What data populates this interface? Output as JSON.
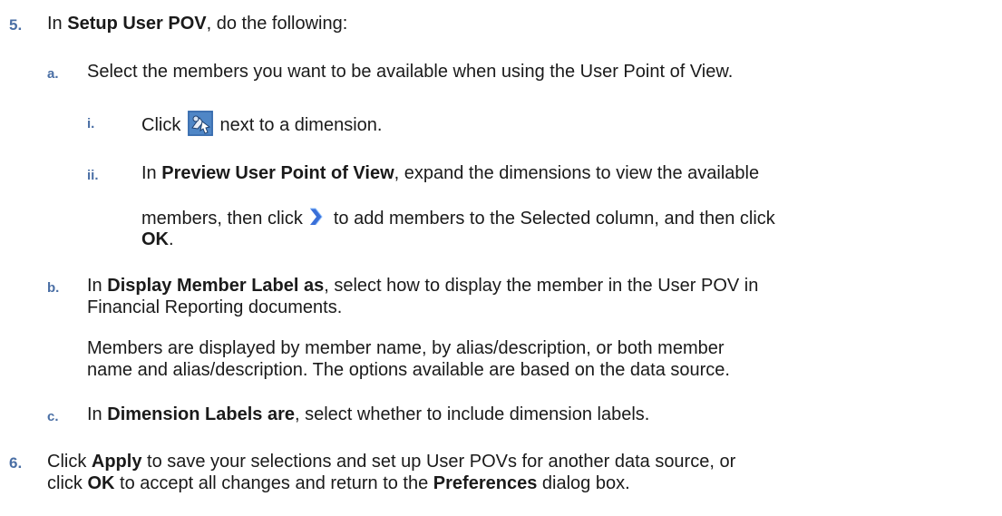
{
  "step5": {
    "number": "5.",
    "pre": "In ",
    "bold": "Setup User POV",
    "post": ", do the following:"
  },
  "step5a": {
    "number": "a.",
    "text": "Select the members you want to be available when using the User Point of View."
  },
  "step5ai": {
    "number": "i.",
    "pre": "Click",
    "post": "next to a dimension.",
    "icon": "member-selection-icon"
  },
  "step5aii": {
    "number": "ii.",
    "line1_pre": "In ",
    "line1_bold": "Preview User Point of View",
    "line1_post": ", expand the dimensions to view the available",
    "line2_pre": "members, then click",
    "line2_post": "to add members to the Selected column, and then click",
    "line3_bold": "OK",
    "line3_post": ".",
    "icon": "chevron-right-icon"
  },
  "step5b": {
    "number": "b.",
    "line1_pre": "In ",
    "line1_bold": "Display Member Label as",
    "line1_post": ", select how to display the member in the User POV in",
    "line2": "Financial Reporting documents.",
    "para1": "Members are displayed by member name, by alias/description, or both member",
    "para2": "name and alias/description. The options available are based on the data source."
  },
  "step5c": {
    "number": "c.",
    "pre": "In ",
    "bold": "Dimension Labels are",
    "post": ", select whether to include dimension labels."
  },
  "step6": {
    "number": "6.",
    "line1_pre": "Click ",
    "line1_bold": "Apply",
    "line1_post": " to save your selections and set up User POVs for another data source, or",
    "line2_pre": "click ",
    "line2_bold": "OK",
    "line2_mid": " to accept all changes and return to the ",
    "line2_bold2": "Preferences",
    "line2_post": " dialog box."
  },
  "colors": {
    "number": "#4a6fa5",
    "text": "#1a1a1a",
    "icon_bg": "#4f86c6",
    "chevron": "#3a6fd8"
  }
}
